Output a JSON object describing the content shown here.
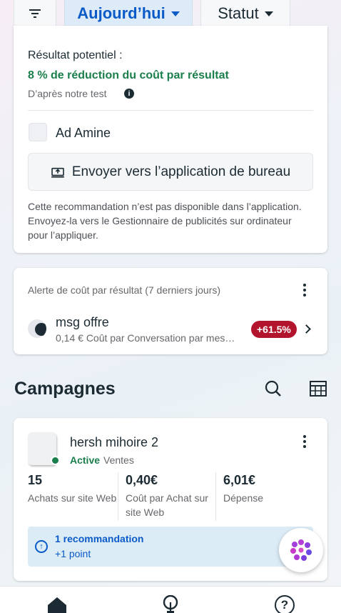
{
  "filters": {
    "today_label": "Aujourd’hui",
    "status_label": "Statut"
  },
  "recommendation_card": {
    "result_label": "Résultat potentiel :",
    "result_value": "8 % de réduction du coût par résultat",
    "test_note": "D’après notre test",
    "ad_name": "Ad Amine",
    "send_button": "Envoyer vers l’application de bureau",
    "unavailable_text": "Cette recommandation n’est pas disponible dans l’application. Envoyez-la vers le Gestionnaire de publicités sur ordinateur pour l’appliquer."
  },
  "alert_card": {
    "title": "Alerte de coût par résultat (7 derniers jours)",
    "item_name": "msg offre",
    "item_detail": "0,14 € Coût par Conversation par mes…",
    "change_badge": "+61.5%"
  },
  "campaigns": {
    "title": "Campagnes",
    "campaign": {
      "name": "hersh mihoire 2",
      "status": "Active",
      "objective": "Ventes",
      "metrics": [
        {
          "value": "15",
          "label": "Achats sur site Web"
        },
        {
          "value": "0,40€",
          "label": "Coût par Achat sur site Web"
        },
        {
          "value": "6,01€",
          "label": "Dépense"
        }
      ],
      "recommendation": {
        "title": "1 recommandation",
        "subtitle": "+1 point"
      }
    }
  },
  "colors": {
    "accent_blue": "#0a5ac7",
    "success_green": "#1a7f4b",
    "alert_red": "#b3142d"
  },
  "icons": [
    "filter-icon",
    "chevron-down-icon",
    "info-icon",
    "desktop-upload-icon",
    "more-icon",
    "chevron-right-icon",
    "search-icon",
    "table-icon",
    "arrow-up-circle-icon",
    "meta-ai-icon",
    "home-icon",
    "lightbulb-icon",
    "help-icon"
  ]
}
